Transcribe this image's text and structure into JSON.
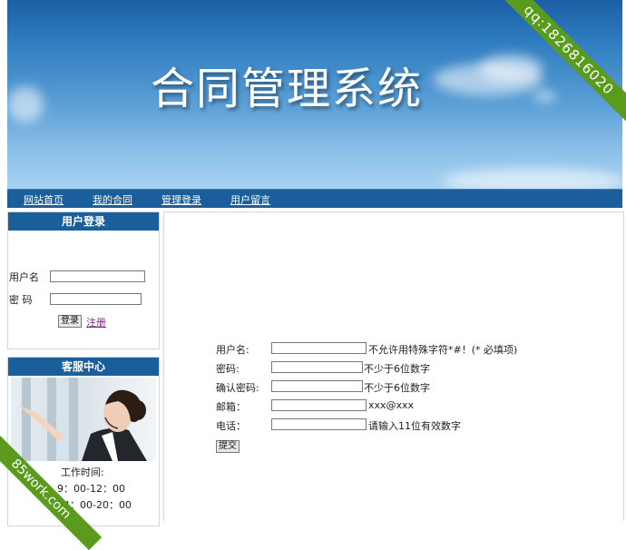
{
  "banner": {
    "title": "合同管理系统"
  },
  "nav": {
    "items": [
      "网站首页",
      "我的合同",
      "管理登录",
      "用户留言"
    ]
  },
  "login": {
    "title": "用户登录",
    "username_label": "用户名",
    "password_label": "密 码",
    "login_button": "登录",
    "register_link": "注册"
  },
  "service": {
    "title": "客服中心",
    "hours_label": "工作时间:",
    "hours_morning": "9：00-12：00",
    "hours_afternoon": "14：00-20：00"
  },
  "register_form": {
    "username_label": "用户名:",
    "username_hint": "不允许用特殊字符*#！(* 必填项)",
    "password_label": "密码:",
    "password_hint": "不少于6位数字",
    "confirm_label": "确认密码:",
    "confirm_hint": "不少于6位数字",
    "email_label": "邮箱：",
    "email_hint": "xxx@xxx",
    "phone_label": "电话：",
    "phone_hint": "请输入11位有效数字",
    "submit_button": "提交"
  },
  "watermarks": {
    "top_right": "qq:1826816020",
    "bottom_left": "85work.com"
  },
  "colors": {
    "nav_bg": "#1a5f9c",
    "ribbon": "#5a9b1e"
  }
}
